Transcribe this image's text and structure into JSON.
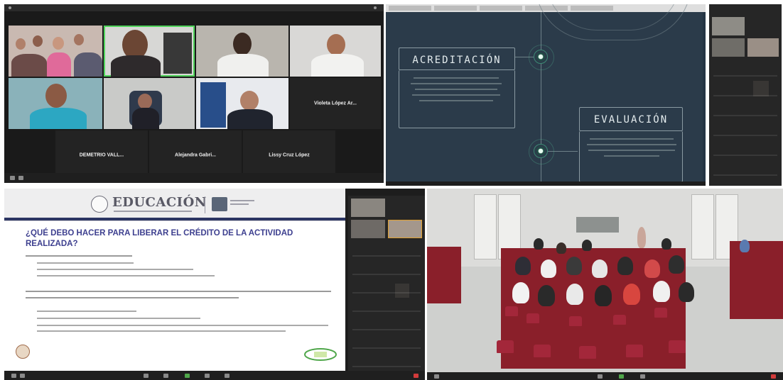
{
  "gallery": {
    "participants": [
      {
        "name": "Violeta López Ar..."
      },
      {
        "name": "DEMETRIO VALL..."
      },
      {
        "name": "Alejandra Gabri..."
      },
      {
        "name": "Lissy Cruz López"
      }
    ]
  },
  "slide_share": {
    "box1_title": "ACREDITACIÓN",
    "box2_title": "EVALUACIÓN"
  },
  "education_slide": {
    "brand": "EDUCACIÓN",
    "heading": "¿QUÉ DEBO HACER PARA LIBERAR EL CRÉDITO DE LA ACTIVIDAD REALIZADA?"
  },
  "colors": {
    "zoom_bg": "#1a1a1a",
    "slide_bg": "#2b3b4a",
    "accent_teal": "#3c8b74",
    "edu_heading": "#3d3f8f",
    "seat_red": "#a3273a"
  }
}
